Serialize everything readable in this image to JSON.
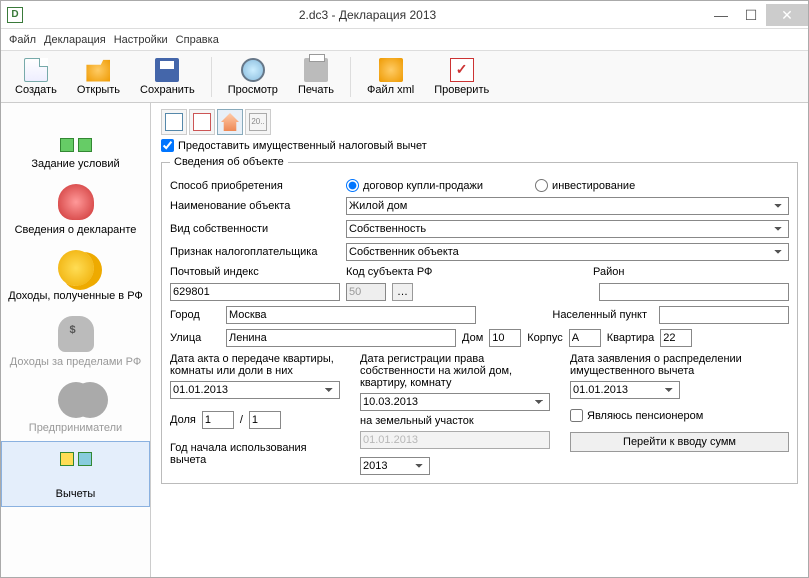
{
  "window": {
    "title": "2.dc3 - Декларация 2013"
  },
  "menubar": [
    "Файл",
    "Декларация",
    "Настройки",
    "Справка"
  ],
  "toolbar": {
    "new": "Создать",
    "open": "Открыть",
    "save": "Сохранить",
    "view": "Просмотр",
    "print": "Печать",
    "xml": "Файл xml",
    "check": "Проверить"
  },
  "sidebar": {
    "items": [
      {
        "label": "Задание условий"
      },
      {
        "label": "Сведения о декларанте"
      },
      {
        "label": "Доходы, полученные в РФ"
      },
      {
        "label": "Доходы за пределами РФ"
      },
      {
        "label": "Предприниматели"
      },
      {
        "label": "Вычеты"
      }
    ]
  },
  "subtabs": [
    "std",
    "soc",
    "prop",
    "doc"
  ],
  "checkbox_label": "Предоставить имущественный налоговый вычет",
  "fieldset_legend": "Сведения об объекте",
  "labels": {
    "acq_method": "Способ приобретения",
    "rad_sale": "договор купли-продажи",
    "rad_invest": "инвестирование",
    "obj_name": "Наименование объекта",
    "own_type": "Вид собственности",
    "payer_type": "Признак налогоплательщика",
    "zip": "Почтовый индекс",
    "region": "Код субъекта РФ",
    "district": "Район",
    "city": "Город",
    "settlement": "Населенный пункт",
    "street": "Улица",
    "house": "Дом",
    "building": "Корпус",
    "flat": "Квартира",
    "date_act": "Дата акта о передаче квартиры, комнаты или доли в них",
    "date_reg": "Дата регистрации права собственности на жилой дом, квартиру, комнату",
    "date_land": "на земельный участок",
    "date_app": "Дата заявления о распределении имущественного вычета",
    "share": "Доля",
    "pensioner": "Являюсь пенсионером",
    "year_start": "Год начала использования вычета",
    "goto_sums": "Перейти к вводу сумм"
  },
  "values": {
    "obj_name": "Жилой дом",
    "own_type": "Собственность",
    "payer_type": "Собственник объекта",
    "zip": "629801",
    "region": "50",
    "district": "",
    "city": "Москва",
    "settlement": "",
    "street": "Ленина",
    "house": "10",
    "building": "А",
    "flat": "22",
    "date_act": "01.01.2013",
    "date_reg": "10.03.2013",
    "date_land": "01.01.2013",
    "date_app": "01.01.2013",
    "share_n": "1",
    "share_d": "1",
    "year_start": "2013"
  }
}
